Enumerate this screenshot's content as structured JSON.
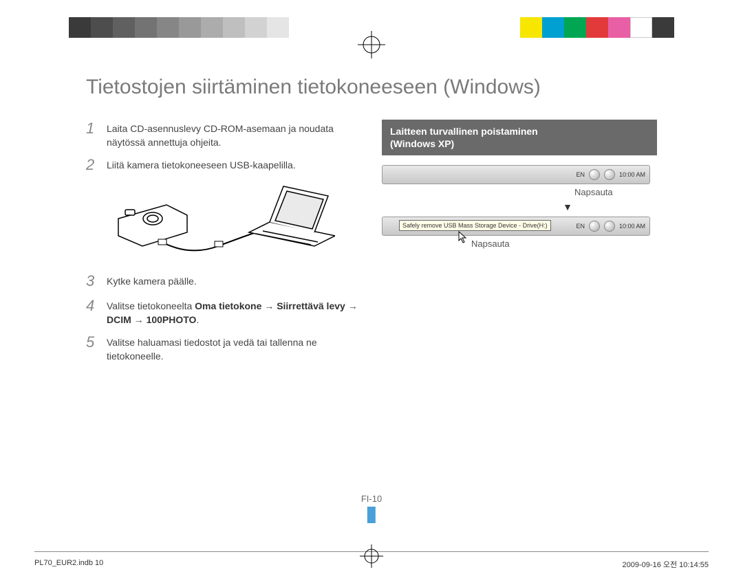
{
  "colorbar": {
    "left": [
      "#3a3a3a",
      "#4d4d4d",
      "#606060",
      "#737373",
      "#868686",
      "#999999",
      "#acacac",
      "#bfbfbf",
      "#d2d2d2",
      "#e5e5e5"
    ],
    "right": [
      "#f7e600",
      "#00a0d2",
      "#00a651",
      "#e23a3a",
      "#e95fa6",
      "#ffffff",
      "#3a3a3a"
    ]
  },
  "title": "Tietostojen siirtäminen tietokoneeseen (Windows)",
  "steps": [
    {
      "num": "1",
      "text": "Laita CD-asennuslevy CD-ROM-asemaan ja noudata näytössä annettuja ohjeita."
    },
    {
      "num": "2",
      "text": "Liitä kamera tietokoneeseen USB-kaapelilla."
    },
    {
      "num": "3",
      "text": "Kytke kamera päälle."
    },
    {
      "num": "4",
      "pre": "Valitse tietokoneelta ",
      "bold1": "Oma tietokone",
      "arr": " → ",
      "bold2": "Siirrettävä levy",
      "arr2": " → ",
      "bold3": "DCIM",
      "arr3": " → ",
      "bold4": "100PHOTO",
      "post": "."
    },
    {
      "num": "5",
      "text": "Valitse haluamasi tiedostot ja vedä tai tallenna ne tietokoneelle."
    }
  ],
  "sidebar": {
    "heading_line1": "Laitteen turvallinen poistaminen",
    "heading_line2": "(Windows XP)",
    "taskbar_lang": "EN",
    "taskbar_time": "10:00 AM",
    "label_click": "Napsauta",
    "tooltip": "Safely remove USB Mass Storage Device - Drive(H:)"
  },
  "page_number": "FI-10",
  "footer": {
    "left": "PL70_EUR2.indb   10",
    "right": "2009-09-16   오전 10:14:55"
  }
}
